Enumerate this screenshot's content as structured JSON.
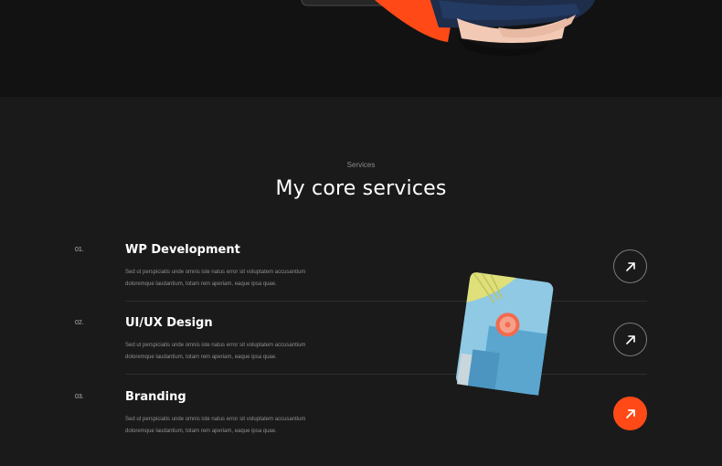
{
  "section": {
    "eyebrow": "Services",
    "title": "My core services"
  },
  "services": [
    {
      "number": "01.",
      "name": "WP Development",
      "desc_line1": "Sed ut perspiciatis unde omnis iste natus error sit voluptatem accusantium",
      "desc_line2": "doloremque laudantium, totam rem aperiam, eaque ipsa quae.",
      "button_icon": "arrow-up-right-icon"
    },
    {
      "number": "02.",
      "name": "UI/UX Design",
      "desc_line1": "Sed ut perspiciatis unde omnis iste natus error sit voluptatem accusantium",
      "desc_line2": "doloremque laudantium, totam rem aperiam, eaque ipsa quae.",
      "button_icon": "arrow-up-right-icon"
    },
    {
      "number": "03.",
      "name": "Branding",
      "desc_line1": "Sed ut perspiciatis unde omnis iste natus error sit voluptatem accusantium",
      "desc_line2": "doloremque laudantium, totam rem aperiam, eaque ipsa quae.",
      "button_icon": "arrow-up-right-icon",
      "active": true
    }
  ],
  "colors": {
    "accent": "#ff4a17",
    "background": "#1a1a1a",
    "hero_background": "#121212"
  }
}
